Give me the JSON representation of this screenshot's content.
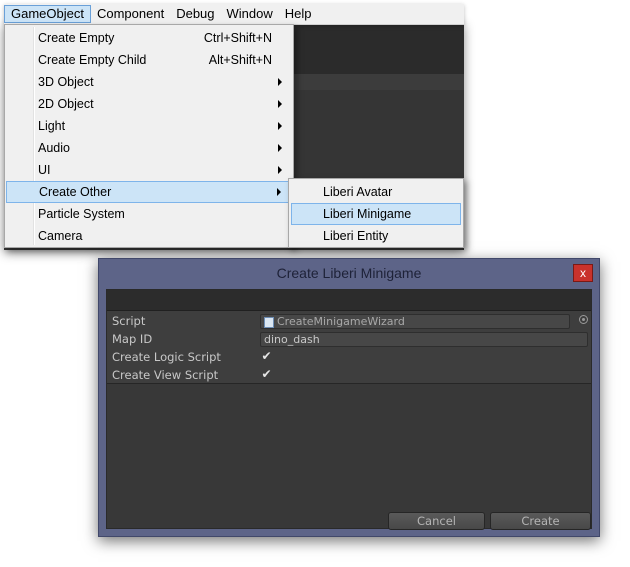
{
  "menubar": {
    "items": [
      "GameObject",
      "Component",
      "Debug",
      "Window",
      "Help"
    ]
  },
  "dropdown": {
    "items": [
      {
        "label": "Create Empty",
        "shortcut": "Ctrl+Shift+N"
      },
      {
        "label": "Create Empty Child",
        "shortcut": "Alt+Shift+N"
      },
      {
        "label": "3D Object"
      },
      {
        "label": "2D Object"
      },
      {
        "label": "Light"
      },
      {
        "label": "Audio"
      },
      {
        "label": "UI"
      },
      {
        "label": "Create Other"
      },
      {
        "label": "Particle System"
      },
      {
        "label": "Camera"
      }
    ]
  },
  "submenu": {
    "items": [
      "Liberi Avatar",
      "Liberi Minigame",
      "Liberi Entity"
    ]
  },
  "dialog": {
    "title": "Create Liberi Minigame",
    "close_glyph": "x",
    "fields": {
      "script_label": "Script",
      "script_value": "CreateMinigameWizard",
      "map_id_label": "Map ID",
      "map_id_value": "dino_dash",
      "logic_label": "Create Logic Script",
      "logic_checked": true,
      "view_label": "Create View Script",
      "view_checked": true
    },
    "buttons": {
      "cancel": "Cancel",
      "create": "Create"
    }
  },
  "check_glyph": "✔"
}
